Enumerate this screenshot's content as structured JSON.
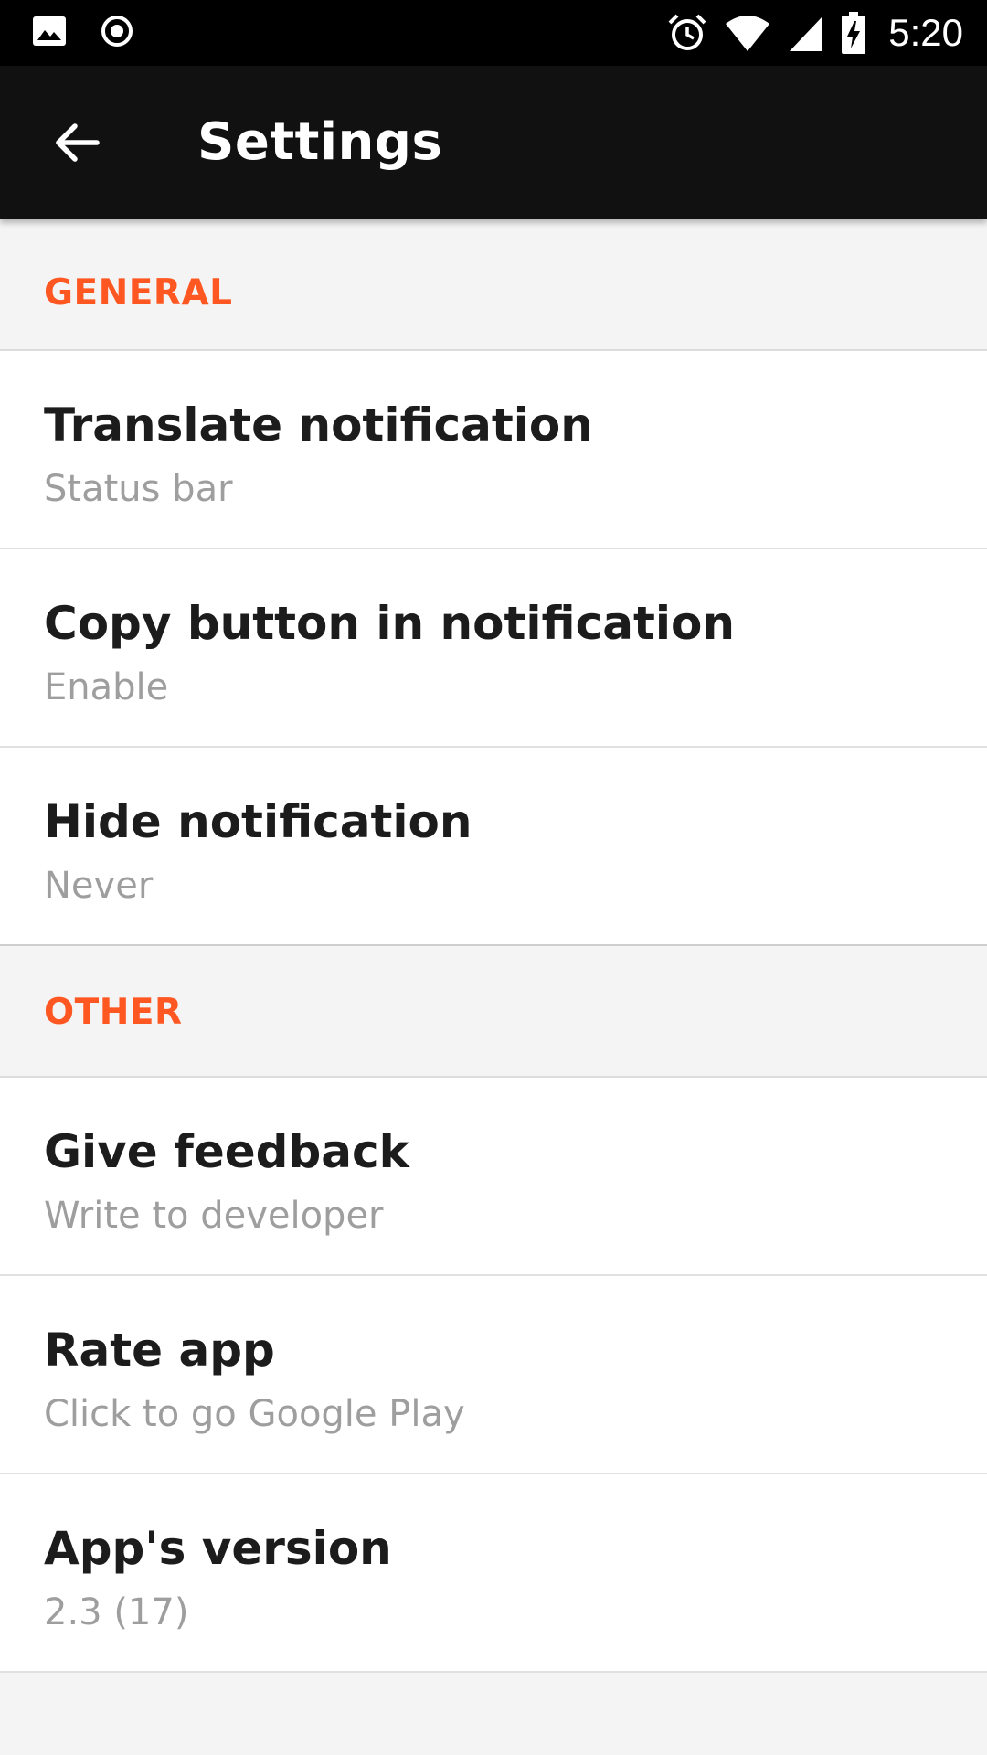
{
  "status_bar": {
    "time": "5:20",
    "icons": [
      "image-icon",
      "record-icon",
      "alarm-icon",
      "wifi-icon",
      "cell-signal-icon",
      "battery-charging-icon"
    ]
  },
  "app_bar": {
    "title": "Settings",
    "back_icon": "arrow-back-icon"
  },
  "colors": {
    "accent": "#ff5722",
    "toolbar": "#111111",
    "status_bar": "#000000",
    "background": "#f4f4f4",
    "title_text": "#1c1c1c",
    "summary_text": "#9e9e9e"
  },
  "sections": {
    "general": {
      "header": "GENERAL",
      "items": [
        {
          "title": "Translate notification",
          "summary": "Status bar"
        },
        {
          "title": "Copy button in notification",
          "summary": "Enable"
        },
        {
          "title": "Hide notification",
          "summary": "Never"
        }
      ]
    },
    "other": {
      "header": "OTHER",
      "items": [
        {
          "title": "Give feedback",
          "summary": "Write to developer"
        },
        {
          "title": "Rate app",
          "summary": "Click to go Google Play"
        },
        {
          "title": "App's version",
          "summary": "2.3 (17)"
        }
      ]
    }
  }
}
